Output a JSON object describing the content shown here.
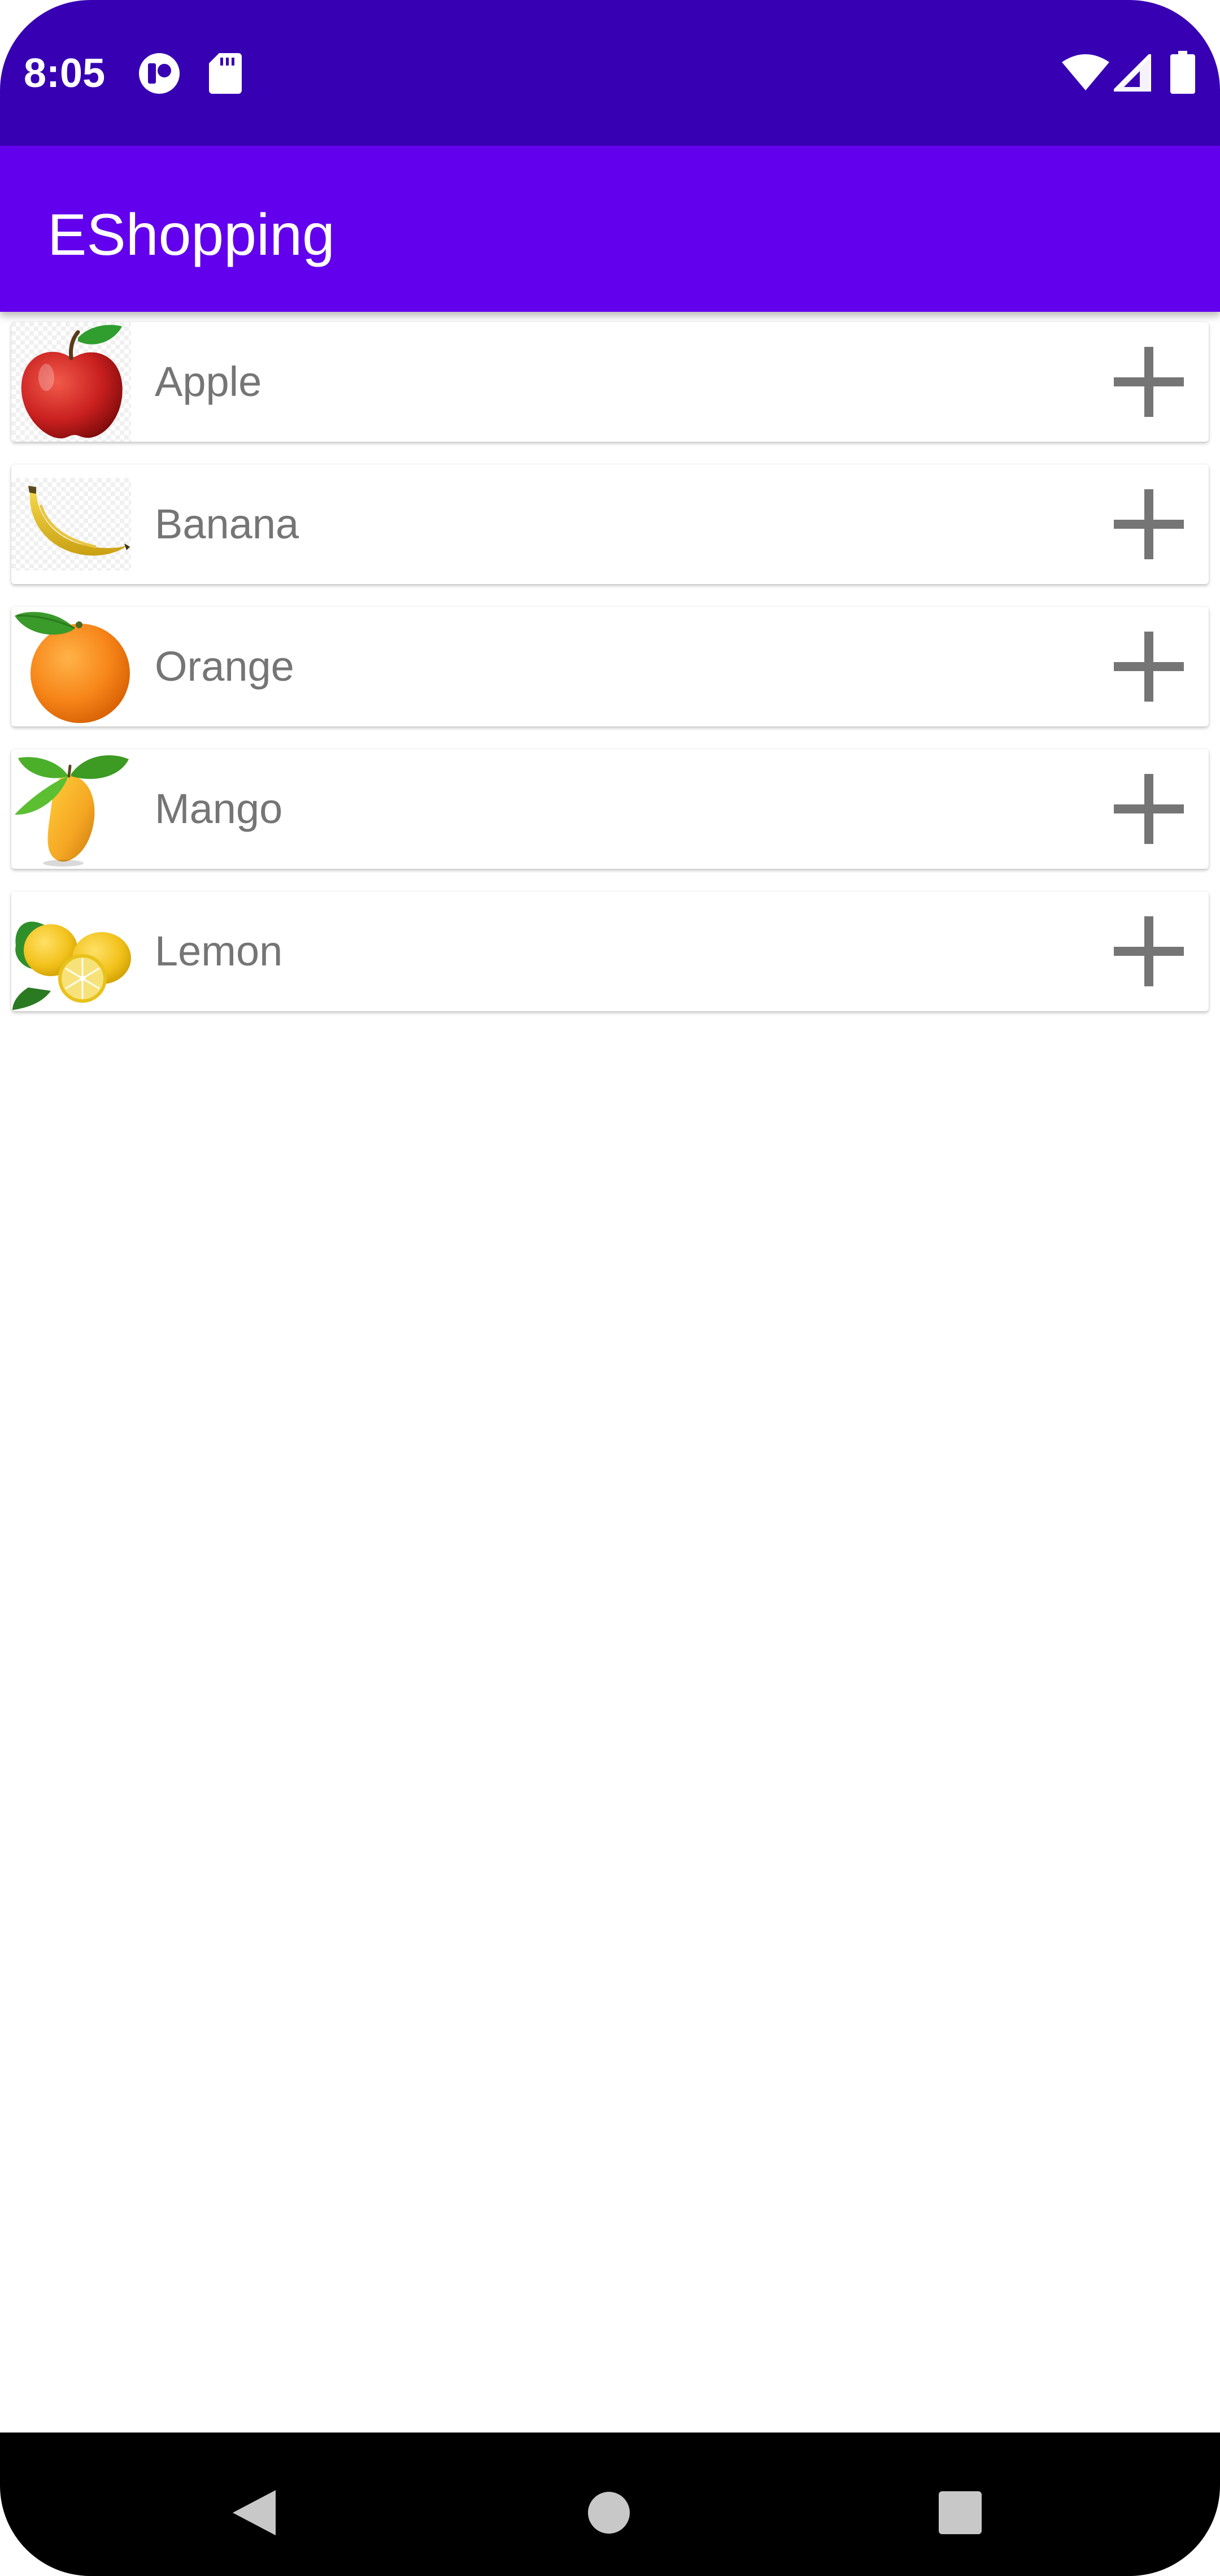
{
  "status_bar": {
    "time": "8:05",
    "left_icons": [
      "app-notification-icon",
      "sd-card-icon"
    ],
    "right_icons": [
      "wifi-icon",
      "cell-signal-icon",
      "battery-icon"
    ]
  },
  "app_bar": {
    "title": "EShopping"
  },
  "colors": {
    "status_bar": "#3700b3",
    "app_bar": "#6200ee",
    "item_text": "#757575",
    "add_icon": "#757575"
  },
  "products": [
    {
      "name": "Apple",
      "image": "apple-image",
      "action_icon": "add-icon"
    },
    {
      "name": "Banana",
      "image": "banana-image",
      "action_icon": "add-icon"
    },
    {
      "name": "Orange",
      "image": "orange-image",
      "action_icon": "add-icon"
    },
    {
      "name": "Mango",
      "image": "mango-image",
      "action_icon": "add-icon"
    },
    {
      "name": "Lemon",
      "image": "lemon-image",
      "action_icon": "add-icon"
    }
  ],
  "nav_bar": {
    "icons": [
      "back-icon",
      "home-icon",
      "recents-icon"
    ]
  }
}
